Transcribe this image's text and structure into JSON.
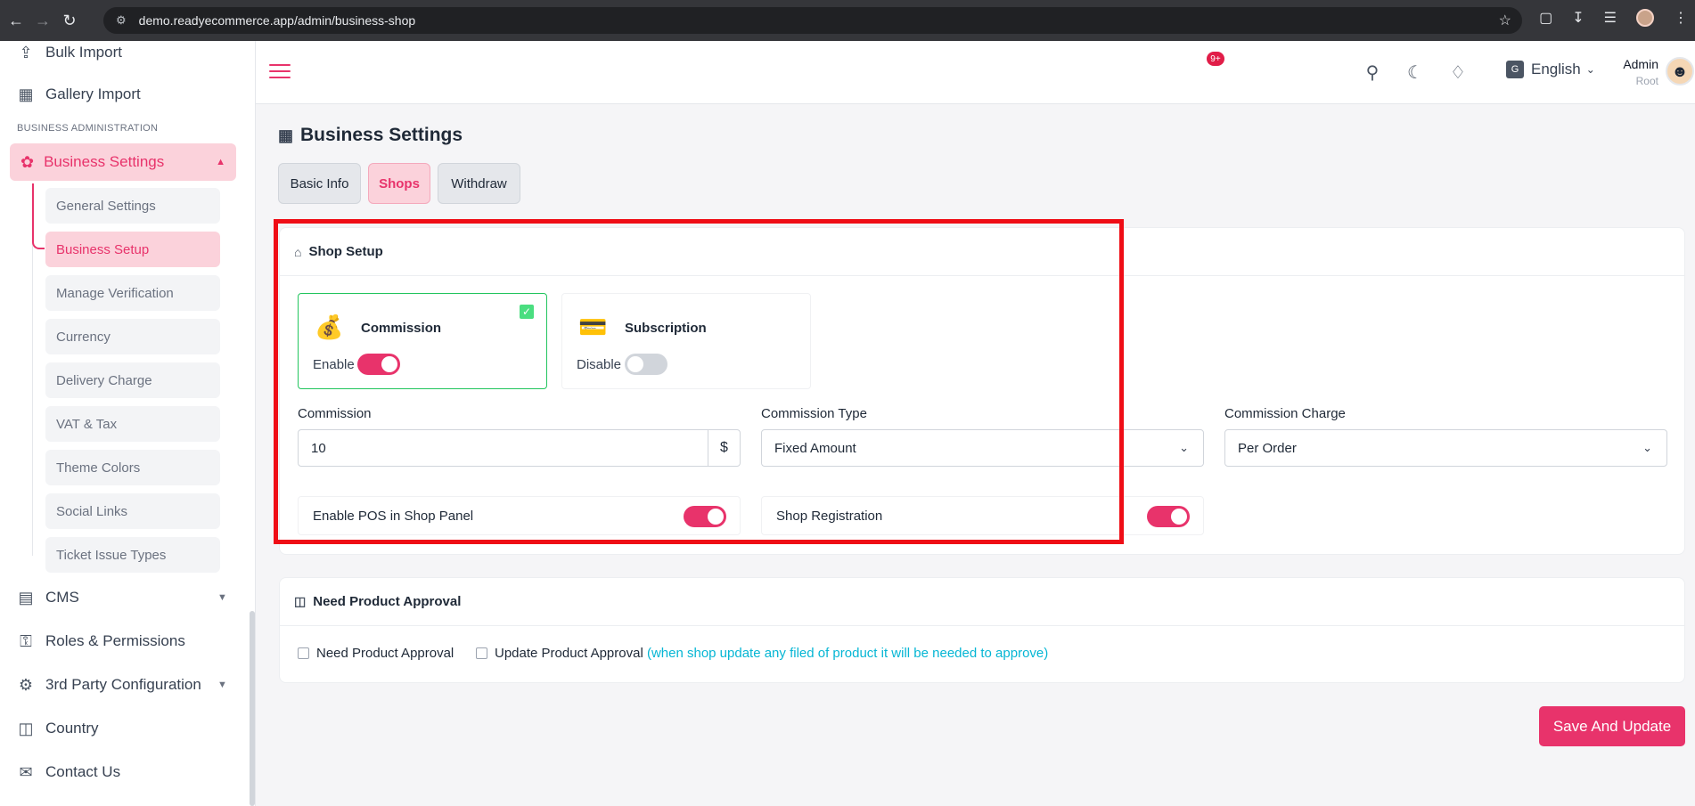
{
  "browser": {
    "url": "demo.readyecommerce.app/admin/business-shop"
  },
  "sidebar": {
    "top_items": [
      {
        "label": "Bulk Import",
        "icon": "upload-icon"
      },
      {
        "label": "Gallery Import",
        "icon": "image-icon"
      }
    ],
    "section_label": "BUSINESS ADMINISTRATION",
    "active_group": {
      "label": "Business Settings",
      "icon": "gear-icon"
    },
    "sub_items": [
      {
        "label": "General Settings",
        "active": false
      },
      {
        "label": "Business Setup",
        "active": true
      },
      {
        "label": "Manage Verification",
        "active": false
      },
      {
        "label": "Currency",
        "active": false
      },
      {
        "label": "Delivery Charge",
        "active": false
      },
      {
        "label": "VAT & Tax",
        "active": false
      },
      {
        "label": "Theme Colors",
        "active": false
      },
      {
        "label": "Social Links",
        "active": false
      },
      {
        "label": "Ticket Issue Types",
        "active": false
      }
    ],
    "bottom_items": [
      {
        "label": "CMS",
        "icon": "document-icon",
        "has_caret": true
      },
      {
        "label": "Roles & Permissions",
        "icon": "key-icon",
        "has_caret": false
      },
      {
        "label": "3rd Party Configuration",
        "icon": "cog-icon",
        "has_caret": true
      },
      {
        "label": "Country",
        "icon": "globe-icon",
        "has_caret": false
      },
      {
        "label": "Contact Us",
        "icon": "chat-icon",
        "has_caret": false
      }
    ]
  },
  "header": {
    "notification_badge": "9+",
    "language": "English",
    "user_name": "Admin",
    "user_role": "Root"
  },
  "page": {
    "title": "Business Settings",
    "tabs": [
      {
        "label": "Basic Info",
        "active": false
      },
      {
        "label": "Shops",
        "active": true
      },
      {
        "label": "Withdraw",
        "active": false
      }
    ]
  },
  "shop_setup": {
    "title": "Shop Setup",
    "plans": [
      {
        "title": "Commission",
        "state": "Enable",
        "on": true,
        "selected": true,
        "icon": "money-bag-icon"
      },
      {
        "title": "Subscription",
        "state": "Disable",
        "on": false,
        "selected": false,
        "icon": "credit-card-icon"
      }
    ],
    "commission_label": "Commission",
    "commission_value": "10",
    "commission_addon": "$",
    "commission_type_label": "Commission Type",
    "commission_type_value": "Fixed Amount",
    "commission_charge_label": "Commission Charge",
    "commission_charge_value": "Per Order",
    "pos_label": "Enable POS in Shop Panel",
    "pos_on": true,
    "registration_label": "Shop Registration",
    "registration_on": true
  },
  "approval": {
    "title": "Need Product Approval",
    "need_label": "Need Product Approval",
    "update_label": "Update Product Approval",
    "update_hint": "(when shop update any filed of product it will be needed to approve)"
  },
  "actions": {
    "save_label": "Save And Update"
  },
  "colors": {
    "accent": "#e8336b",
    "success": "#22c55e",
    "highlight_frame": "#ef0d16",
    "hint": "#06b6d4"
  }
}
